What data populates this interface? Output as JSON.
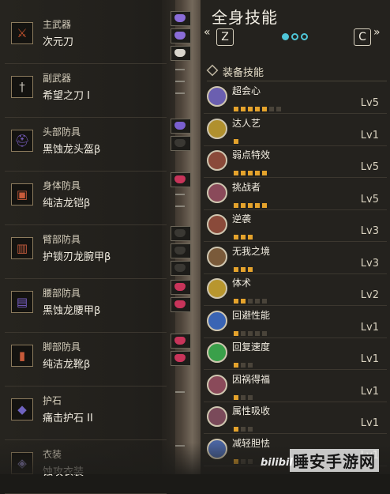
{
  "header": {
    "title": "全身技能",
    "nav_prev_symbol": "«",
    "nav_prev_key": "Z",
    "nav_next_key": "C",
    "nav_next_symbol": "»",
    "page_count": 3,
    "active_page": 1
  },
  "equipment": [
    {
      "type": "主武器",
      "name": "次元刀",
      "icon": "sword-icon",
      "glyph": "⚔",
      "color": "#c8542e"
    },
    {
      "type": "副武器",
      "name": "希望之刀 I",
      "icon": "blade-icon",
      "glyph": "†",
      "color": "#c0bcb2"
    },
    {
      "type": "头部防具",
      "name": "黑蚀龙头盔β",
      "icon": "helmet-icon",
      "glyph": "⛑",
      "color": "#7b5fc4"
    },
    {
      "type": "身体防具",
      "name": "纯洁龙铠β",
      "icon": "chest-armor-icon",
      "glyph": "▣",
      "color": "#c85a3a"
    },
    {
      "type": "臂部防具",
      "name": "护锁刃龙腕甲β",
      "icon": "arm-armor-icon",
      "glyph": "▥",
      "color": "#c05a3c"
    },
    {
      "type": "腰部防具",
      "name": "黑蚀龙腰甲β",
      "icon": "waist-armor-icon",
      "glyph": "▤",
      "color": "#7a60c8"
    },
    {
      "type": "脚部防具",
      "name": "纯洁龙靴β",
      "icon": "leg-armor-icon",
      "glyph": "▮",
      "color": "#c65a3a"
    },
    {
      "type": "护石",
      "name": "痛击护石 II",
      "icon": "charm-icon",
      "glyph": "◆",
      "color": "#6f63c0"
    },
    {
      "type": "衣装",
      "name": "蚀攻衣装",
      "icon": "mantle-icon",
      "glyph": "◈",
      "color": "#9a8fd0"
    }
  ],
  "slots": [
    [
      "#8a6cd8",
      "#8a6cd8",
      "#d8d4cc"
    ],
    [
      "empty",
      "empty",
      "empty"
    ],
    [
      "#7a5fd0",
      "#3a3833"
    ],
    [
      "#c8345a",
      "empty",
      "empty"
    ],
    [
      "#3a3833",
      "#3a3833",
      "#3a3833"
    ],
    [
      "#c8345a",
      "#c8345a"
    ],
    [
      "#c8345a",
      "#c8345a"
    ],
    [
      "empty"
    ],
    [
      "empty"
    ]
  ],
  "skills_section_label": "装备技能",
  "skills": [
    {
      "name": "超会心",
      "level_text": "Lv5",
      "level": 5,
      "max": 7,
      "icon": "critical-boost-icon",
      "ring": "#6b5fb0"
    },
    {
      "name": "达人艺",
      "level_text": "Lv1",
      "level": 1,
      "max": 1,
      "icon": "mastery-icon",
      "ring": "#b0902e"
    },
    {
      "name": "弱点特效",
      "level_text": "Lv5",
      "level": 5,
      "max": 5,
      "icon": "weakness-exploit-icon",
      "ring": "#8a4a3a"
    },
    {
      "name": "挑战者",
      "level_text": "Lv5",
      "level": 5,
      "max": 5,
      "icon": "challenger-icon",
      "ring": "#8a4a5a"
    },
    {
      "name": "逆袭",
      "level_text": "Lv3",
      "level": 3,
      "max": 3,
      "icon": "counterstrike-icon",
      "ring": "#8a4a3a"
    },
    {
      "name": "无我之境",
      "level_text": "Lv3",
      "level": 3,
      "max": 3,
      "icon": "latent-power-icon",
      "ring": "#7a5a3a"
    },
    {
      "name": "体术",
      "level_text": "Lv2",
      "level": 2,
      "max": 5,
      "icon": "constitution-icon",
      "ring": "#b8962e"
    },
    {
      "name": "回避性能",
      "level_text": "Lv1",
      "level": 1,
      "max": 5,
      "icon": "evade-window-icon",
      "ring": "#3a64b4"
    },
    {
      "name": "回复速度",
      "level_text": "Lv1",
      "level": 1,
      "max": 3,
      "icon": "recovery-speed-icon",
      "ring": "#3aa04a"
    },
    {
      "name": "因祸得福",
      "level_text": "Lv1",
      "level": 1,
      "max": 3,
      "icon": "blessing-icon",
      "ring": "#8a4a5a"
    },
    {
      "name": "属性吸收",
      "level_text": "Lv1",
      "level": 1,
      "max": 3,
      "icon": "element-absorb-icon",
      "ring": "#7a4a5a"
    },
    {
      "name": "减轻胆怯",
      "level_text": "Lv1",
      "level": 1,
      "max": 3,
      "icon": "flinch-free-icon",
      "ring": "#4a64a0"
    }
  ],
  "watermark": "睡安手游网",
  "bilibili_mark": "bilibili"
}
